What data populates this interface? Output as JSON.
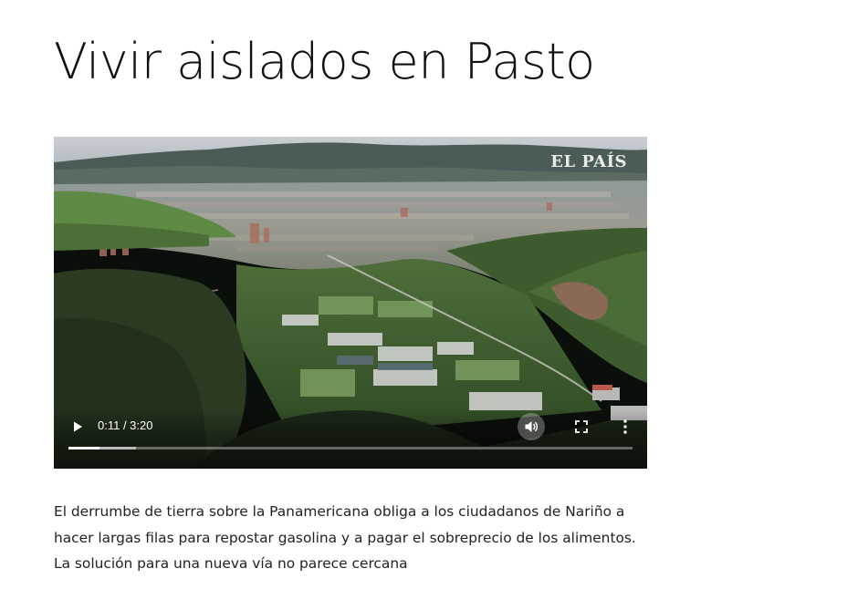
{
  "article": {
    "title": "Vivir aislados en Pasto",
    "summary": "El derrumbe de tierra sobre la Panamericana obliga a los ciudadanos de Nariño a hacer largas filas para repostar gasolina y a pagar el sobreprecio de los alimentos. La solución para una nueva vía no parece cercana"
  },
  "video": {
    "watermark": "EL PAÍS",
    "time_display": "0:11 / 3:20",
    "progress_fraction": 0.055,
    "buffered_fraction": 0.12,
    "icons": {
      "play": "play-icon",
      "volume": "volume-icon",
      "fullscreen": "fullscreen-icon",
      "more": "more-options-icon"
    }
  }
}
